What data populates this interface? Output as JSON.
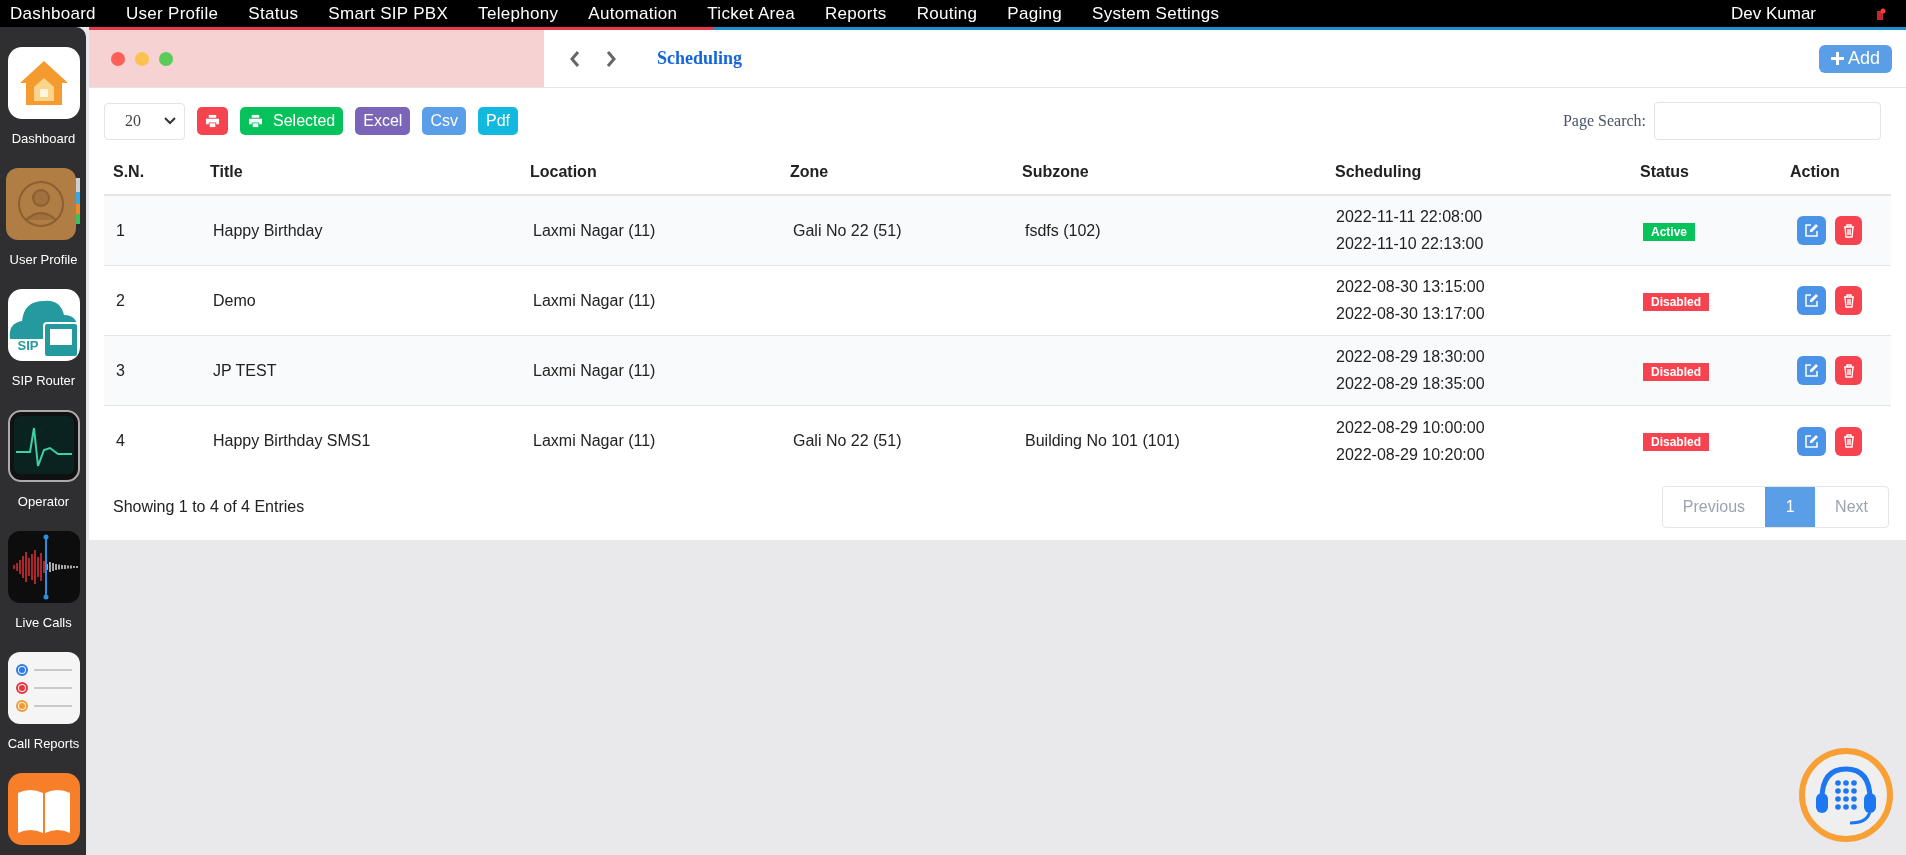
{
  "menu": {
    "items": [
      "Dashboard",
      "User Profile",
      "Status",
      "Smart SIP PBX",
      "Telephony",
      "Automation",
      "Ticket Area",
      "Reports",
      "Routing",
      "Paging",
      "System Settings"
    ],
    "user": "Dev Kumar"
  },
  "sidebar": {
    "items": [
      {
        "kind": "home",
        "label": "Dashboard"
      },
      {
        "kind": "contacts",
        "label": "User Profile"
      },
      {
        "kind": "sip",
        "label": "SIP Router",
        "badge": "SIP"
      },
      {
        "kind": "monitor",
        "label": "Operator"
      },
      {
        "kind": "wave",
        "label": "Live Calls"
      },
      {
        "kind": "list",
        "label": "Call Reports"
      },
      {
        "kind": "book"
      }
    ]
  },
  "page": {
    "title": "Scheduling",
    "add_button": "Add"
  },
  "toolbar": {
    "page_size": "20",
    "buttons": [
      {
        "kind": "print"
      },
      {
        "kind": "selected",
        "label": "Selected"
      },
      {
        "kind": "excel",
        "label": "Excel"
      },
      {
        "kind": "csv",
        "label": "Csv"
      },
      {
        "kind": "pdf",
        "label": "Pdf"
      }
    ],
    "search_label": "Page Search:"
  },
  "table": {
    "columns": [
      "S.N.",
      "Title",
      "Location",
      "Zone",
      "Subzone",
      "Scheduling",
      "Status",
      "Action"
    ],
    "rows": [
      {
        "sn": "1",
        "title": "Happy Birthday",
        "location": "Laxmi Nagar (11)",
        "zone": "Gali No 22 (51)",
        "subzone": "fsdfs (102)",
        "start": "2022-11-11 22:08:00",
        "end": "2022-11-10 22:13:00",
        "status": {
          "label": "Active",
          "kind": "active"
        }
      },
      {
        "sn": "2",
        "title": "Demo",
        "location": "Laxmi Nagar (11)",
        "start": "2022-08-30 13:15:00",
        "end": "2022-08-30 13:17:00",
        "status": {
          "label": "Disabled",
          "kind": "disabled"
        }
      },
      {
        "sn": "3",
        "title": "JP TEST",
        "location": "Laxmi Nagar (11)",
        "start": "2022-08-29 18:30:00",
        "end": "2022-08-29 18:35:00",
        "status": {
          "label": "Disabled",
          "kind": "disabled"
        }
      },
      {
        "sn": "4",
        "title": "Happy Birthday SMS1",
        "location": "Laxmi Nagar (11)",
        "zone": "Gali No 22 (51)",
        "subzone": "Building No 101 (101)",
        "start": "2022-08-29 10:00:00",
        "end": "2022-08-29 10:20:00",
        "status": {
          "label": "Disabled",
          "kind": "disabled"
        }
      }
    ]
  },
  "footer": {
    "info": "Showing 1 to 4 of 4 Entries",
    "pagination": {
      "previous": {
        "label": "Previous",
        "disabled": true
      },
      "pages": [
        {
          "label": "1",
          "selected": true
        }
      ],
      "next": {
        "label": "Next",
        "disabled": true
      }
    }
  }
}
